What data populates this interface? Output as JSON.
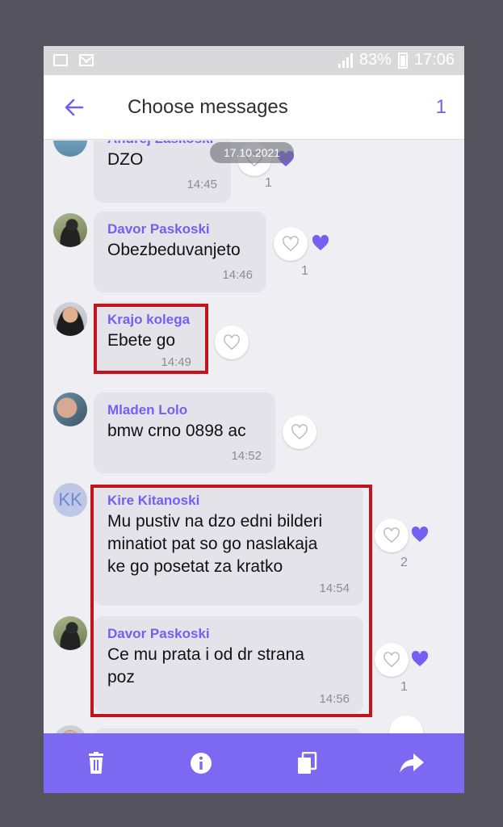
{
  "status_bar": {
    "battery": "83%",
    "time": "17:06"
  },
  "header": {
    "title": "Choose messages",
    "selected_count": "1"
  },
  "date_separator": "17.10.2021",
  "messages": [
    {
      "sender": "Andrej Laskoski",
      "text": "DZO",
      "time": "14:45",
      "likes": "1"
    },
    {
      "sender": "Davor Paskoski",
      "text": "Obezbeduvanjeto",
      "time": "14:46",
      "likes": "1"
    },
    {
      "sender": "Krajo kolega",
      "text": "Ebete go",
      "time": "14:49"
    },
    {
      "sender": "Mladen Lolo",
      "text": "bmw crno 0898 ac",
      "time": "14:52"
    },
    {
      "sender": "Kire Kitanoski",
      "avatar_initials": "KK",
      "lines": [
        "Mu pustiv na dzo edni bilderi",
        "minatiot pat so go naslakaja",
        "ke go posetat za kratko"
      ],
      "time": "14:54",
      "likes": "2"
    },
    {
      "sender": "Davor Paskoski",
      "lines": [
        "Ce mu prata i od dr strana",
        "poz"
      ],
      "time": "14:56",
      "likes": "1"
    }
  ],
  "toolbar": {
    "icons": [
      "trash-icon",
      "info-icon",
      "copy-icon",
      "share-icon"
    ]
  },
  "colors": {
    "accent": "#7360f2",
    "toolbar": "#7d68f2",
    "bubble": "#e4e3ea",
    "highlight": "#c4141b"
  }
}
